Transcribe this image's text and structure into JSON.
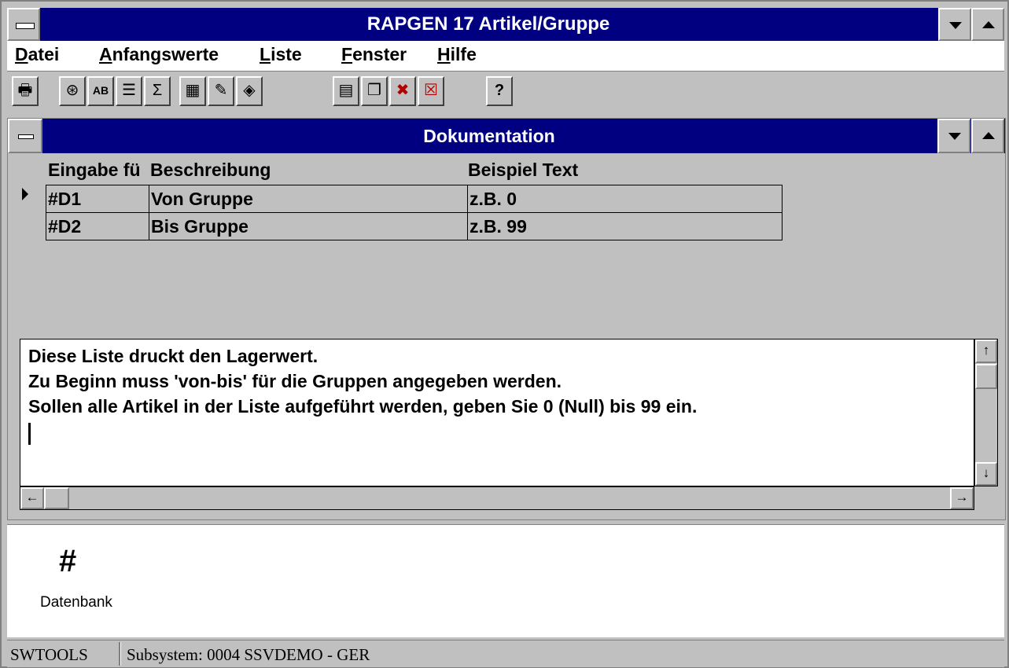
{
  "app": {
    "title": "RAPGEN 17 Artikel/Gruppe"
  },
  "menu": {
    "items": [
      "Datei",
      "Anfangswerte",
      "Liste",
      "Fenster",
      "Hilfe"
    ]
  },
  "toolbar": {
    "buttons": [
      {
        "name": "print-icon",
        "glyph": "🖶"
      },
      {
        "name": "record-icon",
        "glyph": "⊛"
      },
      {
        "name": "text-field-icon",
        "glyph": "AB"
      },
      {
        "name": "list-icon",
        "glyph": "☰"
      },
      {
        "name": "sum-icon",
        "glyph": "Σ"
      },
      {
        "name": "calculator-icon",
        "glyph": "▦"
      },
      {
        "name": "edit-icon",
        "glyph": "✎"
      },
      {
        "name": "select-icon",
        "glyph": "◈"
      },
      {
        "name": "layout-icon",
        "glyph": "▤"
      },
      {
        "name": "windows-icon",
        "glyph": "❐"
      },
      {
        "name": "delete-grid-icon",
        "glyph": "✖"
      },
      {
        "name": "close-window-icon",
        "glyph": "☒"
      },
      {
        "name": "help-icon",
        "glyph": "?"
      }
    ]
  },
  "child": {
    "title": "Dokumentation",
    "grid": {
      "columns": [
        "Eingabe fü",
        "Beschreibung",
        "Beispiel Text"
      ],
      "rows": [
        [
          "#D1",
          "Von Gruppe",
          "z.B. 0"
        ],
        [
          "#D2",
          "Bis Gruppe",
          "z.B. 99"
        ]
      ]
    },
    "text": {
      "lines": [
        "Diese Liste druckt den Lagerwert.",
        "Zu Beginn muss 'von-bis' für die Gruppen angegeben werden.",
        "Sollen alle Artikel in der Liste aufgeführt werden, geben Sie 0 (Null) bis 99 ein."
      ]
    }
  },
  "desktop": {
    "icon_label": "Datenbank",
    "icon_glyph": "#"
  },
  "status": {
    "app": "SWTOOLS",
    "subsystem": "Subsystem: 0004 SSVDEMO - GER"
  },
  "colors": {
    "titlebar": "#000080",
    "face": "#c0c0c0"
  }
}
